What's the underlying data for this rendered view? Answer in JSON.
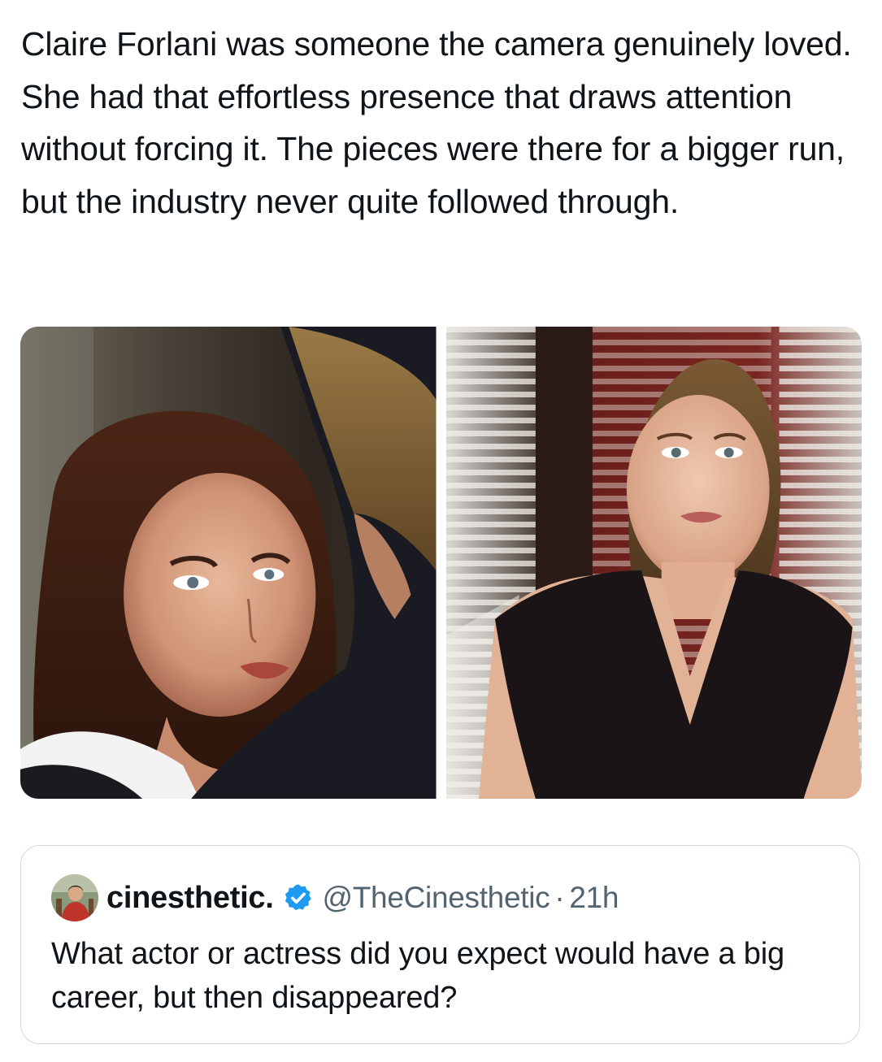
{
  "tweet": {
    "text": "Claire Forlani was someone the camera genuinely loved. She had that effortless presence that draws attention without forcing it. The pieces were there for a bigger run, but the industry never quite followed through."
  },
  "media": [
    {
      "id": "photo-left"
    },
    {
      "id": "photo-right"
    }
  ],
  "quoted_tweet": {
    "display_name": "cinesthetic.",
    "handle": "@TheCinesthetic",
    "separator": "·",
    "time": "21h",
    "verified_icon": "verified-badge-icon",
    "text": "What actor or actress did you expect would have a big career, but then disappeared?"
  },
  "colors": {
    "text_primary": "#0f1419",
    "text_secondary": "#536471",
    "border": "#cfd9de",
    "verified_blue": "#1d9bf0"
  }
}
